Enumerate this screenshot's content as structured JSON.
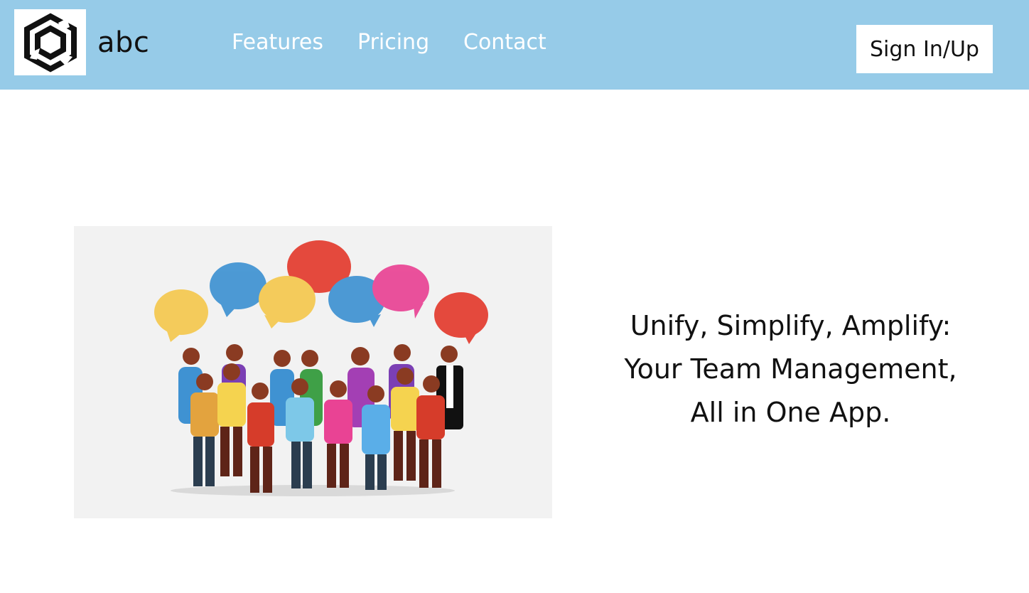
{
  "brand": {
    "name": "abc",
    "logo_icon": "hexagon-logo-icon"
  },
  "nav": {
    "links": [
      {
        "label": "Features"
      },
      {
        "label": "Pricing"
      },
      {
        "label": "Contact"
      }
    ],
    "signin_label": "Sign In/Up"
  },
  "hero": {
    "illustration": "crowd-with-speech-bubbles-illustration",
    "tagline": [
      "Unify, Simplify, Amplify:",
      "Your Team Management,",
      "All in One App."
    ]
  },
  "colors": {
    "navbar": "#96cbe8",
    "nav_link": "#ffffff",
    "text": "#111111",
    "illustration_bg": "#f2f2f2"
  }
}
